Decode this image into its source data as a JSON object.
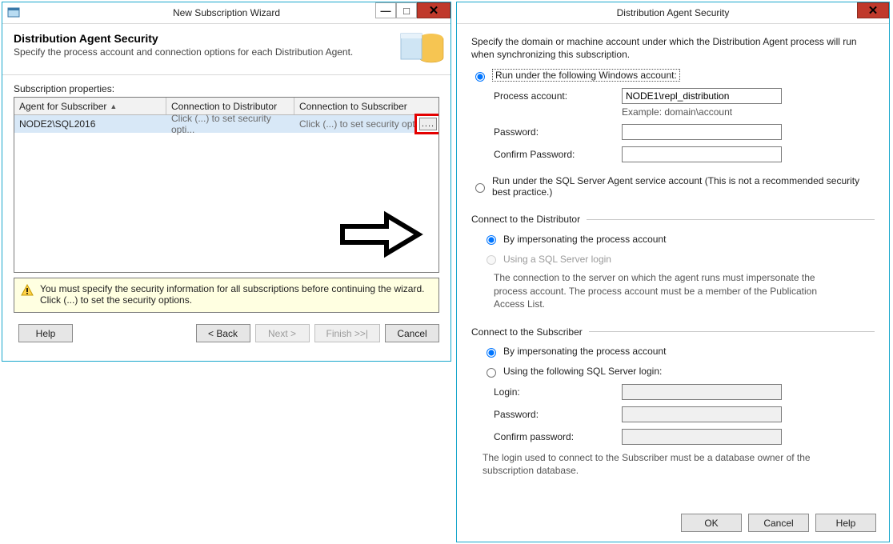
{
  "wizard": {
    "title": "New Subscription Wizard",
    "header_title": "Distribution Agent Security",
    "header_sub": "Specify the process account and connection options for each Distribution Agent.",
    "subprops_label": "Subscription properties:",
    "columns": {
      "agent": "Agent for Subscriber",
      "dist": "Connection to Distributor",
      "sub": "Connection to Subscriber"
    },
    "row": {
      "agent": "NODE2\\SQL2016",
      "dist": "Click (...) to set security opti...",
      "sub": "Click (...) to set security opti..."
    },
    "ellipsis": "....",
    "warning": "You must specify the security information for all subscriptions before continuing the wizard. Click (...) to set the security options.",
    "buttons": {
      "help": "Help",
      "back": "< Back",
      "next": "Next >",
      "finish": "Finish >>|",
      "cancel": "Cancel"
    }
  },
  "security": {
    "title": "Distribution Agent Security",
    "intro": "Specify the domain or machine account under which the Distribution Agent process will run when synchronizing this subscription.",
    "run_windows": "Run under the following Windows account:",
    "process_account_label": "Process account:",
    "process_account_value": "NODE1\\repl_distribution",
    "example": "Example: domain\\account",
    "password_label": "Password:",
    "confirm_password_label": "Confirm Password:",
    "run_sqlagent": "Run under the SQL Server Agent service account (This is not a recommended security best practice.)",
    "connect_distributor_title": "Connect to the Distributor",
    "dist_impersonate": "By impersonating the process account",
    "dist_sqllogin": "Using a SQL Server login",
    "dist_note": "The connection to the server on which the agent runs must impersonate the process account. The process account must be a member of the Publication Access List.",
    "connect_subscriber_title": "Connect to the Subscriber",
    "sub_impersonate": "By impersonating the process account",
    "sub_sqllogin": "Using the following SQL Server login:",
    "login_label": "Login:",
    "sub_password_label": "Password:",
    "sub_confirm_password_label": "Confirm password:",
    "sub_note": "The login used to connect to the Subscriber must be a database owner of the subscription database.",
    "buttons": {
      "ok": "OK",
      "cancel": "Cancel",
      "help": "Help"
    }
  }
}
